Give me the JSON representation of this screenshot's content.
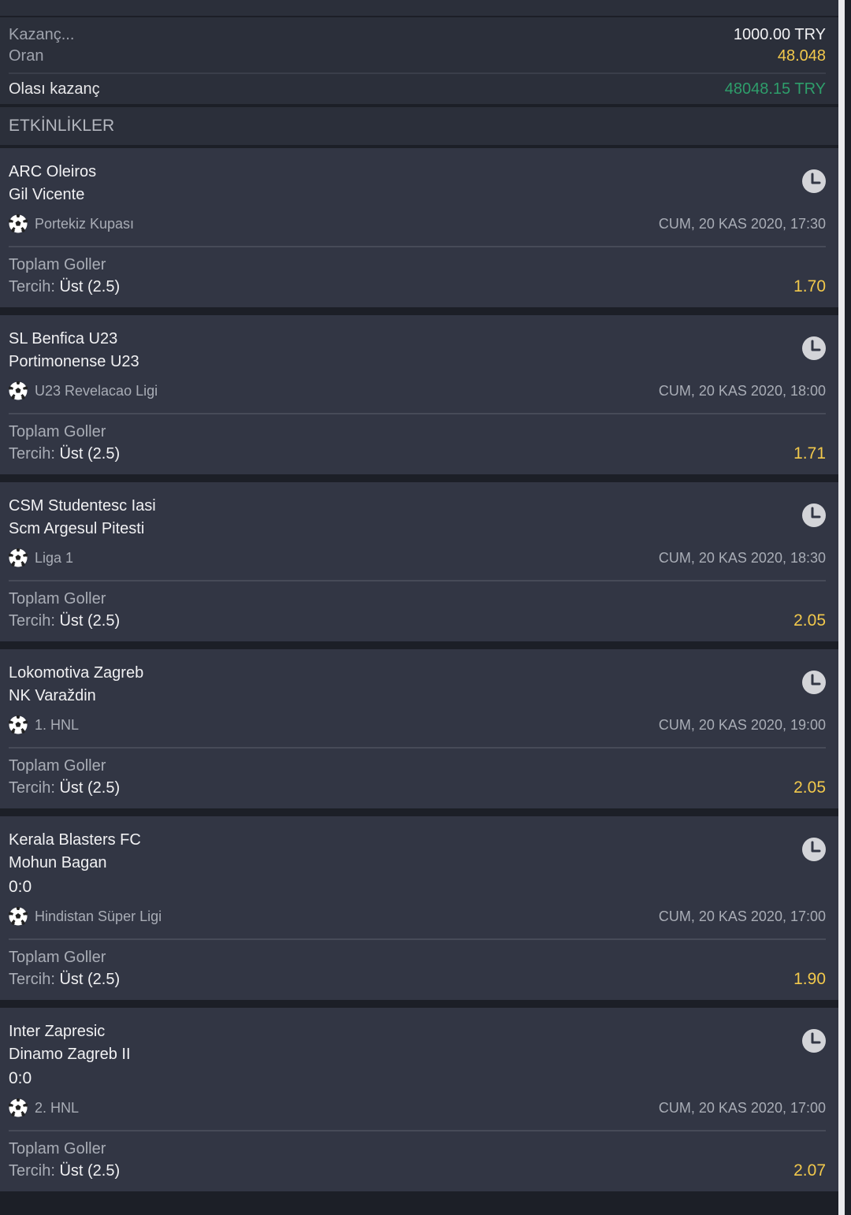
{
  "summary": {
    "stake_label": "Kazanç...",
    "stake_value": "1000.00 TRY",
    "odds_label": "Oran",
    "odds_value": "48.048",
    "payout_label": "Olası kazanç",
    "payout_value": "48048.15 TRY"
  },
  "section_title": "ETKİNLİKLER",
  "events": [
    {
      "home": "ARC Oleiros",
      "away": "Gil Vicente",
      "score": "",
      "league": "Portekiz Kupası",
      "date": "CUM, 20 KAS 2020, 17:30",
      "market": "Toplam Goller",
      "pick_label": "Tercih:",
      "pick_value": "Üst (2.5)",
      "odds": "1.70"
    },
    {
      "home": "SL Benfica U23",
      "away": "Portimonense U23",
      "score": "",
      "league": "U23 Revelacao Ligi",
      "date": "CUM, 20 KAS 2020, 18:00",
      "market": "Toplam Goller",
      "pick_label": "Tercih:",
      "pick_value": "Üst (2.5)",
      "odds": "1.71"
    },
    {
      "home": "CSM Studentesc Iasi",
      "away": "Scm Argesul Pitesti",
      "score": "",
      "league": "Liga 1",
      "date": "CUM, 20 KAS 2020, 18:30",
      "market": "Toplam Goller",
      "pick_label": "Tercih:",
      "pick_value": "Üst (2.5)",
      "odds": "2.05"
    },
    {
      "home": "Lokomotiva Zagreb",
      "away": "NK Varaždin",
      "score": "",
      "league": "1. HNL",
      "date": "CUM, 20 KAS 2020, 19:00",
      "market": "Toplam Goller",
      "pick_label": "Tercih:",
      "pick_value": "Üst (2.5)",
      "odds": "2.05"
    },
    {
      "home": "Kerala Blasters FC",
      "away": "Mohun Bagan",
      "score": "0:0",
      "league": "Hindistan Süper Ligi",
      "date": "CUM, 20 KAS 2020, 17:00",
      "market": "Toplam Goller",
      "pick_label": "Tercih:",
      "pick_value": "Üst (2.5)",
      "odds": "1.90"
    },
    {
      "home": "Inter Zapresic",
      "away": "Dinamo Zagreb II",
      "score": "0:0",
      "league": "2. HNL",
      "date": "CUM, 20 KAS 2020, 17:00",
      "market": "Toplam Goller",
      "pick_label": "Tercih:",
      "pick_value": "Üst (2.5)",
      "odds": "2.07"
    }
  ]
}
